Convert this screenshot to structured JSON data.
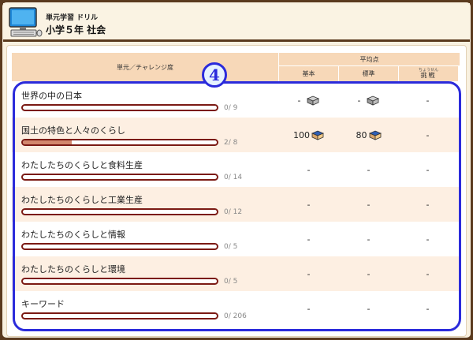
{
  "header": {
    "subtitle": "単元学習 ドリル",
    "title": "小学５年 社会",
    "icon": "computer-icon"
  },
  "table": {
    "col_unit": "単元／チャレンジ度",
    "col_avg": "平均点",
    "col_basic": "基本",
    "col_standard": "標準",
    "col_challenge_ruby": "ちょうせん",
    "col_challenge": "挑戦"
  },
  "badge": "4",
  "rows": [
    {
      "title": "世界の中の日本",
      "count": "0/ 9",
      "progress": 0,
      "basic": "-",
      "standard": "-",
      "challenge": "-",
      "basic_icon": "gray-book-icon",
      "standard_icon": "gray-book-icon"
    },
    {
      "title": "国土の特色と人々のくらし",
      "count": "2/ 8",
      "progress": 0.25,
      "basic": "100",
      "standard": "80",
      "challenge": "-",
      "basic_icon": "blue-book-icon",
      "standard_icon": "blue-book-icon"
    },
    {
      "title": "わたしたちのくらしと食料生産",
      "count": "0/ 14",
      "progress": 0,
      "basic": "-",
      "standard": "-",
      "challenge": "-"
    },
    {
      "title": "わたしたちのくらしと工業生産",
      "count": "0/ 12",
      "progress": 0,
      "basic": "-",
      "standard": "-",
      "challenge": "-"
    },
    {
      "title": "わたしたちのくらしと情報",
      "count": "0/ 5",
      "progress": 0,
      "basic": "-",
      "standard": "-",
      "challenge": "-"
    },
    {
      "title": "わたしたちのくらしと環境",
      "count": "0/ 5",
      "progress": 0,
      "basic": "-",
      "standard": "-",
      "challenge": "-"
    },
    {
      "title": "キーワード",
      "count": "0/ 206",
      "progress": 0,
      "basic": "-",
      "standard": "-",
      "challenge": "-"
    }
  ],
  "colors": {
    "highlight": "#2b2bdb",
    "bar_border": "#7b1a14",
    "bar_fill": "#d2876d",
    "header_bg": "#f7d8b8",
    "alt_row": "#fdefe2"
  }
}
